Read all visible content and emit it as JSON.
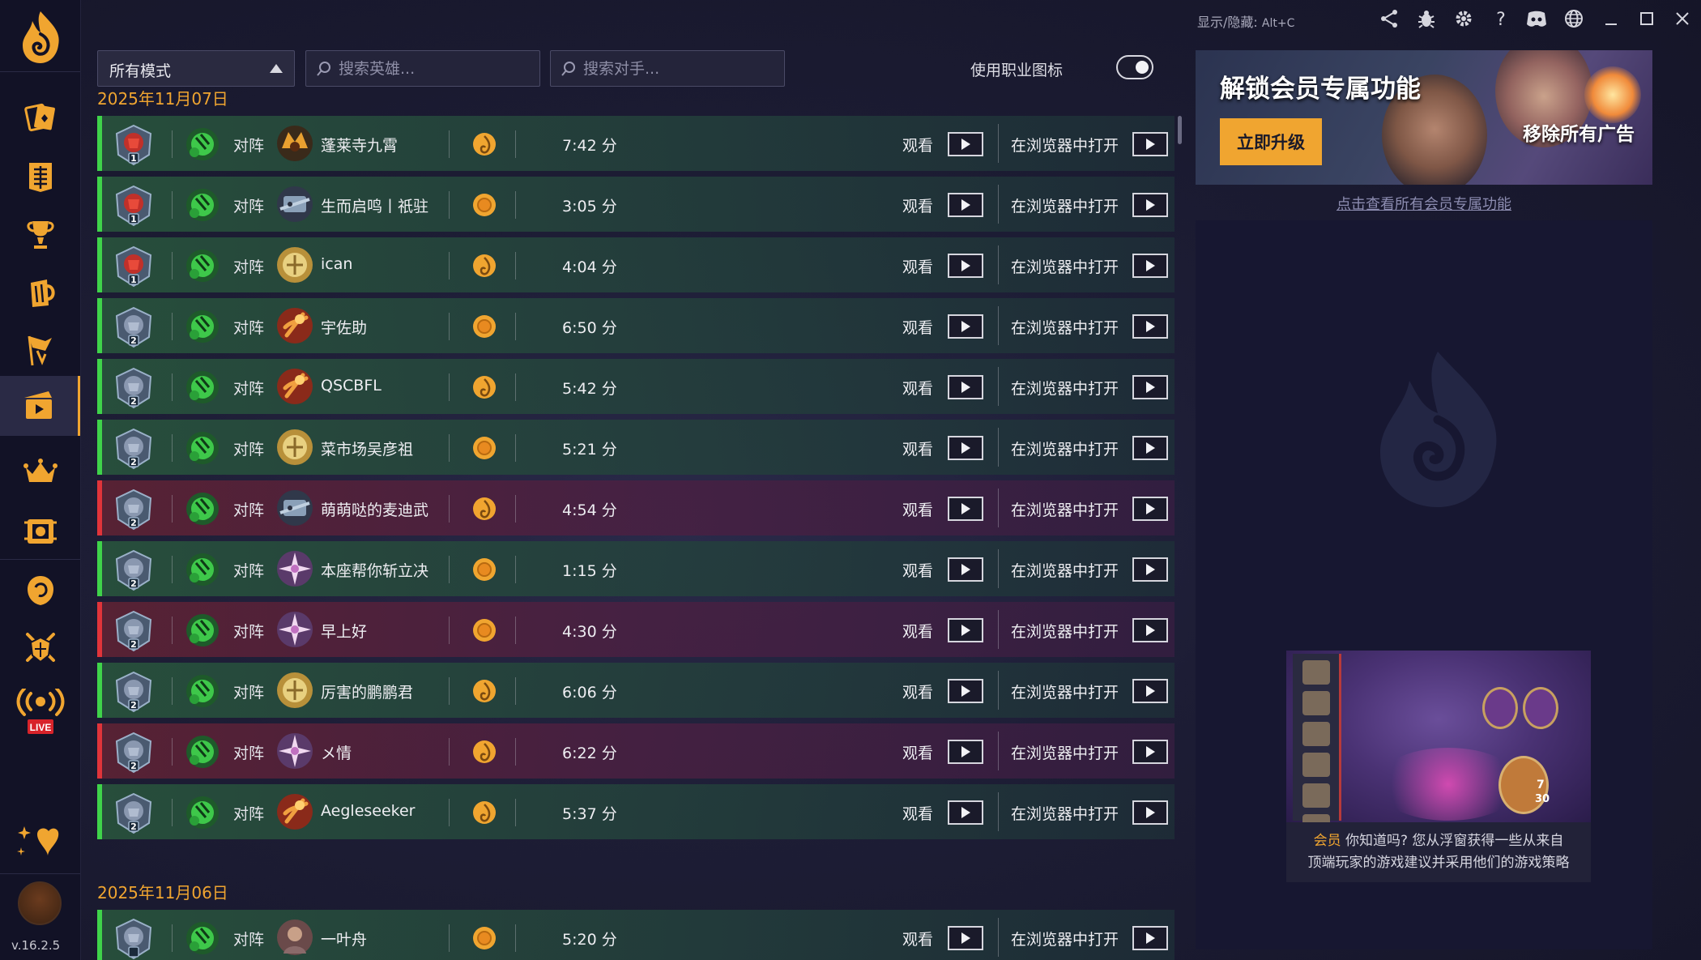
{
  "app": {
    "version": "v.16.2.5"
  },
  "titlebar": {
    "hint": "显示/隐藏:",
    "shortcut": "Alt+C"
  },
  "sidebar": {
    "items": [
      {
        "icon": "cards-icon"
      },
      {
        "icon": "deck-list-icon"
      },
      {
        "icon": "trophy-icon"
      },
      {
        "icon": "tavern-mug-icon"
      },
      {
        "icon": "arena-banner-icon"
      },
      {
        "icon": "replays-icon",
        "active": true
      },
      {
        "icon": "crown-icon"
      },
      {
        "icon": "tavern-board-icon"
      },
      {
        "icon": "mercenary-icon"
      },
      {
        "icon": "shield-swords-icon"
      }
    ],
    "live_badge": "LIVE"
  },
  "filters": {
    "mode": "所有模式",
    "hero_search_placeholder": "搜索英雄...",
    "opponent_search_placeholder": "搜索对手...",
    "class_icon_label": "使用职业图标",
    "class_icon_enabled": true
  },
  "labels": {
    "vs": "对阵",
    "watch": "观看",
    "open_in_browser": "在浏览器中打开"
  },
  "colors": {
    "win": "#3fd34a",
    "loss": "#e0343a",
    "accent": "#f0a530"
  },
  "date_groups": [
    {
      "date": "2025年11月07日",
      "games": [
        {
          "rank": "1",
          "result": "win",
          "opponent": "蓬莱寺九霄",
          "opponent_icon": "warlock-icon",
          "coin": "first",
          "duration": "7:42 分"
        },
        {
          "rank": "1",
          "result": "win",
          "opponent": "生而启鸣丨祇驻",
          "opponent_icon": "mech-icon",
          "coin": "second",
          "duration": "3:05 分"
        },
        {
          "rank": "1",
          "result": "win",
          "opponent": "ican",
          "opponent_icon": "paladin-icon",
          "coin": "first",
          "duration": "4:04 分"
        },
        {
          "rank": "2",
          "result": "win",
          "opponent": "宇佐助",
          "opponent_icon": "mage-icon",
          "coin": "second",
          "duration": "6:50 分"
        },
        {
          "rank": "2",
          "result": "win",
          "opponent": "QSCBFL",
          "opponent_icon": "mage-icon",
          "coin": "first",
          "duration": "5:42 分"
        },
        {
          "rank": "2",
          "result": "win",
          "opponent": "菜市场吴彦祖",
          "opponent_icon": "paladin-icon",
          "coin": "second",
          "duration": "5:21 分"
        },
        {
          "rank": "2",
          "result": "loss",
          "opponent": "萌萌哒的麦迪武",
          "opponent_icon": "mech-icon",
          "coin": "first",
          "duration": "4:54 分"
        },
        {
          "rank": "2",
          "result": "win",
          "opponent": "本座帮你斩立决",
          "opponent_icon": "priest-icon",
          "coin": "second",
          "duration": "1:15 分"
        },
        {
          "rank": "2",
          "result": "loss",
          "opponent": "早上好",
          "opponent_icon": "priest-icon",
          "coin": "second",
          "duration": "4:30 分"
        },
        {
          "rank": "2",
          "result": "win",
          "opponent": "厉害的鹏鹏君",
          "opponent_icon": "paladin-icon",
          "coin": "first",
          "duration": "6:06 分"
        },
        {
          "rank": "2",
          "result": "loss",
          "opponent": "メ情",
          "opponent_icon": "priest-icon",
          "coin": "first",
          "duration": "6:22 分"
        },
        {
          "rank": "2",
          "result": "win",
          "opponent": "Aegleseeker",
          "opponent_icon": "mage-icon",
          "coin": "first",
          "duration": "5:37 分"
        }
      ]
    },
    {
      "date": "2025年11月06日",
      "games": [
        {
          "rank": "",
          "result": "win",
          "opponent": "一叶舟",
          "opponent_icon": "hero-portrait-icon",
          "coin": "second",
          "duration": "5:20 分"
        }
      ]
    }
  ],
  "promo": {
    "title": "解锁会员专属功能",
    "upgrade_button": "立即升级",
    "remove_ads": "移除所有广告",
    "link": "点击查看所有会员专属功能"
  },
  "tip": {
    "tag": "会员",
    "line1": "你知道吗? 您从浮窗获得一些从来自",
    "line2": "顶端玩家的游戏建议并采用他们的游戏策略",
    "stat_attack": "7",
    "stat_health": "30"
  }
}
